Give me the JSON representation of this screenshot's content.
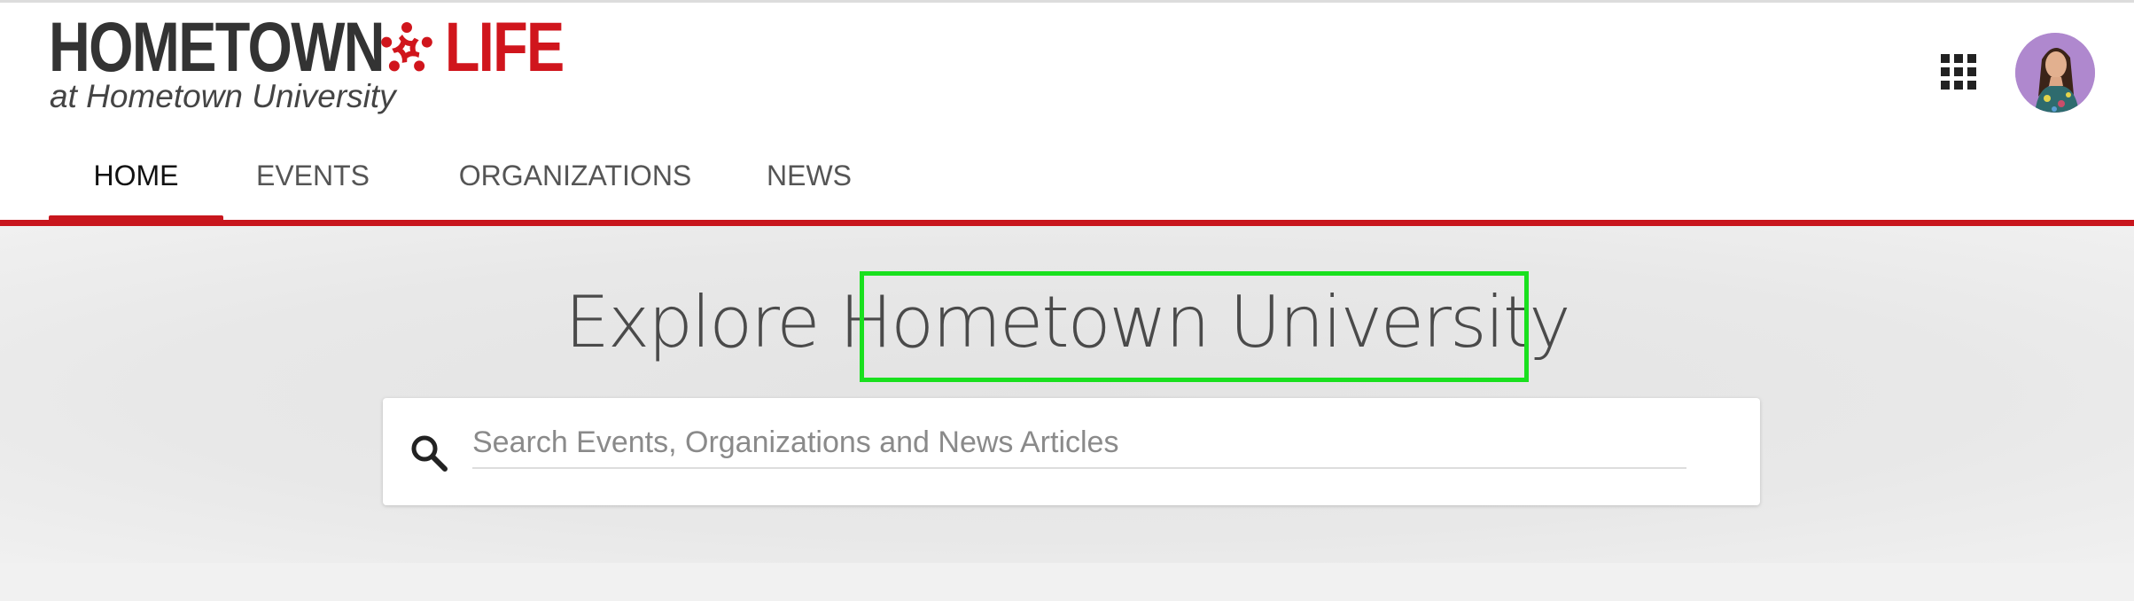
{
  "brand": {
    "name_part1": "HOMETOWN",
    "name_part2": "LIFE",
    "subtitle": "at Hometown University",
    "accent_color": "#c8161d"
  },
  "header": {
    "apps_icon": "grid-apps-icon",
    "avatar_icon": "user-avatar"
  },
  "nav": {
    "tabs": [
      {
        "label": "HOME",
        "active": true
      },
      {
        "label": "EVENTS",
        "active": false
      },
      {
        "label": "ORGANIZATIONS",
        "active": false
      },
      {
        "label": "NEWS",
        "active": false
      }
    ]
  },
  "hero": {
    "title_prefix": "Explore",
    "title_highlight": "Hometown University",
    "highlight_color": "#19e01e"
  },
  "search": {
    "icon": "search-icon",
    "placeholder": "Search Events, Organizations and News Articles",
    "value": ""
  }
}
